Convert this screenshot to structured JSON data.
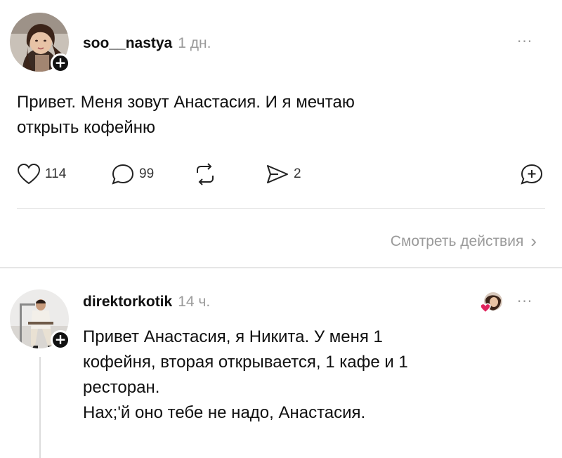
{
  "post1": {
    "username": "soo__nastya",
    "time": "1 дн.",
    "text_line1": "Привет. Меня зовут Анастасия. И я мечтаю",
    "text_line2": "открыть кофейню",
    "likes": "114",
    "comments": "99",
    "shares": "2",
    "view_activity": "Смотреть действия",
    "follow": "+",
    "more": "···",
    "chevron": "›"
  },
  "post2": {
    "username": "direktorkotik",
    "time": "14 ч.",
    "text_line1": "Привет Анастасия, я Никита. У меня 1",
    "text_line2": "кофейня, вторая открывается, 1 кафе и 1",
    "text_line3": "ресторан.",
    "text_line4": "Нах;'й оно тебе не надо, Анастасия.",
    "follow": "+",
    "more": "···"
  },
  "icons": [
    "heart-icon",
    "comment-icon",
    "repost-icon",
    "send-icon",
    "quote-icon",
    "more-icon",
    "chevron-right-icon"
  ],
  "colors": {
    "text": "#101010",
    "muted": "#9a9a9a",
    "divider": "#e2e2e2",
    "reaction_heart": "#e0245e"
  }
}
